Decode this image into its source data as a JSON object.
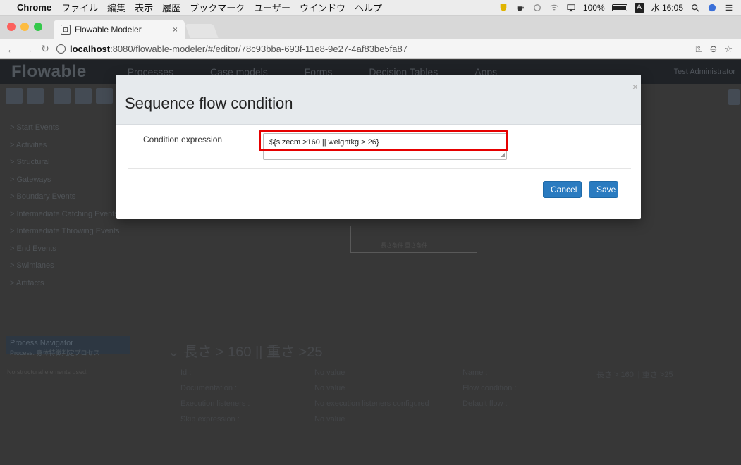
{
  "menubar": {
    "apple": "",
    "app": "Chrome",
    "items": [
      "ファイル",
      "編集",
      "表示",
      "履歴",
      "ブックマーク",
      "ユーザー",
      "ウインドウ",
      "ヘルプ"
    ],
    "battery": "100%",
    "input_badge": "A",
    "clock": "水 16:05"
  },
  "browser": {
    "tab_title": "Flowable Modeler",
    "tab_close": "×",
    "url_host": "localhost",
    "url_path": ":8080/flowable-modeler/#/editor/78c93bba-693f-11e8-9e27-4af83be5fa87"
  },
  "app": {
    "logo": "Flowable",
    "nav": [
      "Processes",
      "Case models",
      "Forms",
      "Decision Tables",
      "Apps"
    ],
    "user": "Test Administrator",
    "palette": [
      "Start Events",
      "Activities",
      "Structural",
      "Gateways",
      "Boundary Events",
      "Intermediate Catching Events",
      "Intermediate Throwing Events",
      "End Events",
      "Swimlanes",
      "Artifacts"
    ],
    "process_navigator": "Process Navigator",
    "process_sub": "Process: 身体特徴判定プロセス",
    "no_selection": "No structural elements used.",
    "props_title": "長さ > 160 || 重さ >25",
    "props": {
      "id_label": "Id :",
      "id_value": "No value",
      "name_label": "Name :",
      "name_value": "長さ > 160 || 重さ >25",
      "doc_label": "Documentation :",
      "doc_value": "No value",
      "flow_label": "Flow condition :",
      "exec_label": "Execution listeners :",
      "exec_value": "No execution listeners configured",
      "default_label": "Default flow :",
      "skip_label": "Skip expression :",
      "skip_value": "No value"
    },
    "canvas_label": "長さ条件\n重さ条件"
  },
  "modal": {
    "title": "Sequence flow condition",
    "close": "×",
    "field_label": "Condition expression",
    "expression": "${sizecm >160 || weightkg > 26}",
    "cancel_label": "Cancel",
    "save_label": "Save",
    "highlight_color": "#e60000",
    "primary_color": "#2a7bc0"
  }
}
